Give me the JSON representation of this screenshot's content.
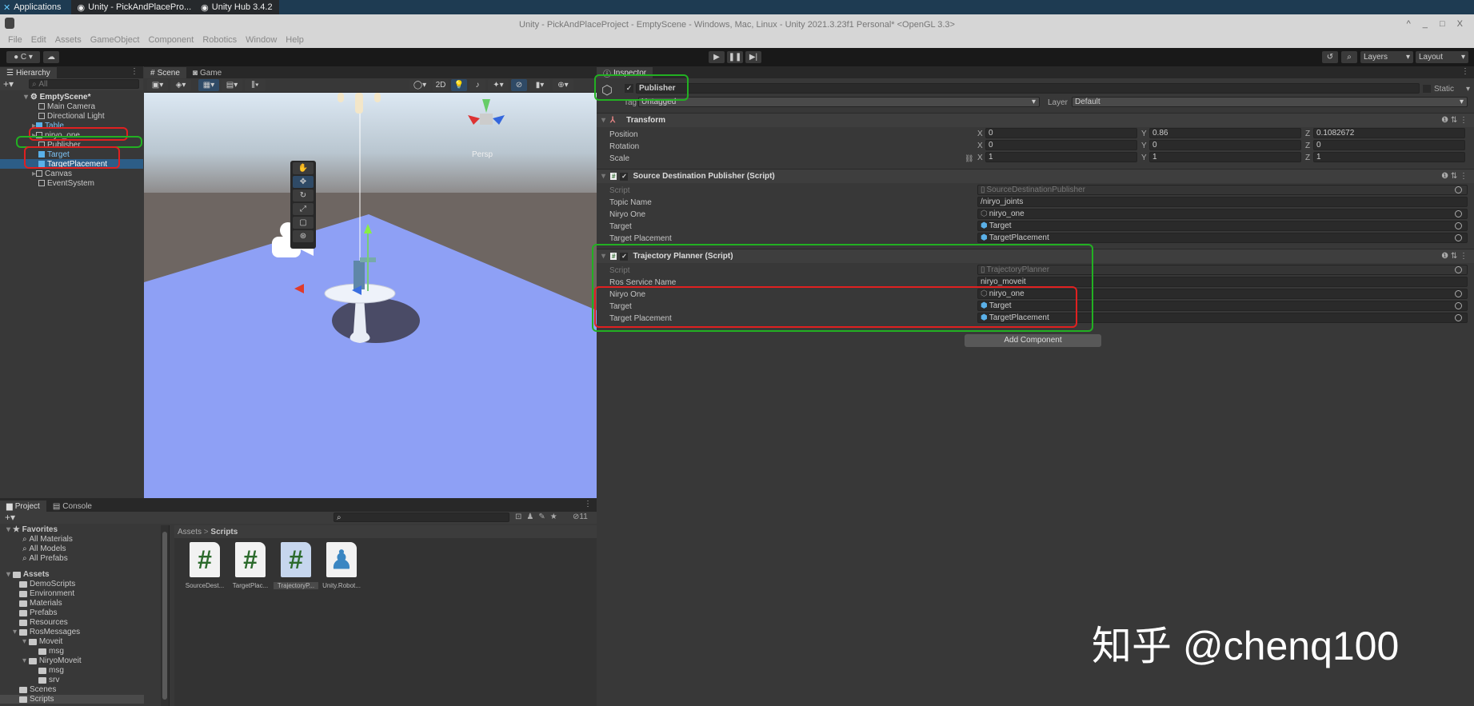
{
  "taskbar": {
    "applications": "Applications",
    "task1": "Unity - PickAndPlacePro...",
    "task2": "Unity Hub 3.4.2"
  },
  "window": {
    "title": "Unity - PickAndPlaceProject - EmptyScene - Windows, Mac, Linux - Unity 2021.3.23f1 Personal* <OpenGL 3.3>",
    "controls": "^ _ □ X"
  },
  "menu": [
    "File",
    "Edit",
    "Assets",
    "GameObject",
    "Component",
    "Robotics",
    "Window",
    "Help"
  ],
  "toolbar": {
    "account": "C",
    "layers": "Layers",
    "layout": "Layout"
  },
  "hierarchy": {
    "tab": "Hierarchy",
    "search_placeholder": "All",
    "scene": "EmptyScene*",
    "items": [
      {
        "label": "Main Camera"
      },
      {
        "label": "Directional Light"
      },
      {
        "label": "Table"
      },
      {
        "label": "niryo_one"
      },
      {
        "label": "Publisher"
      },
      {
        "label": "Target"
      },
      {
        "label": "TargetPlacement"
      },
      {
        "label": "Canvas"
      },
      {
        "label": "EventSystem"
      }
    ]
  },
  "scene": {
    "tab_scene": "Scene",
    "tab_game": "Game",
    "btn_2d": "2D",
    "persp": "Persp"
  },
  "inspector": {
    "tab": "Inspector",
    "object_name": "Publisher",
    "static": "Static",
    "tag_label": "Tag",
    "tag": "Untagged",
    "layer_label": "Layer",
    "layer": "Default",
    "transform": {
      "title": "Transform",
      "position_label": "Position",
      "rotation_label": "Rotation",
      "scale_label": "Scale",
      "position": {
        "x": "0",
        "y": "0.86",
        "z": "0.1082672"
      },
      "rotation": {
        "x": "0",
        "y": "0",
        "z": "0"
      },
      "scale": {
        "x": "1",
        "y": "1",
        "z": "1"
      }
    },
    "sdp": {
      "title": "Source Destination Publisher (Script)",
      "rows": [
        {
          "label": "Script",
          "value": "SourceDestinationPublisher"
        },
        {
          "label": "Topic Name",
          "value": "/niryo_joints"
        },
        {
          "label": "Niryo One",
          "value": "niryo_one"
        },
        {
          "label": "Target",
          "value": "Target"
        },
        {
          "label": "Target Placement",
          "value": "TargetPlacement"
        }
      ]
    },
    "tp": {
      "title": "Trajectory Planner (Script)",
      "rows": [
        {
          "label": "Script",
          "value": "TrajectoryPlanner"
        },
        {
          "label": "Ros Service Name",
          "value": "niryo_moveit"
        },
        {
          "label": "Niryo One",
          "value": "niryo_one"
        },
        {
          "label": "Target",
          "value": "Target"
        },
        {
          "label": "Target Placement",
          "value": "TargetPlacement"
        }
      ]
    },
    "add_component": "Add Component"
  },
  "project": {
    "tab_project": "Project",
    "tab_console": "Console",
    "hidden_count": "11",
    "favorites": "Favorites",
    "fav_items": [
      "All Materials",
      "All Models",
      "All Prefabs"
    ],
    "assets": "Assets",
    "folders": [
      "DemoScripts",
      "Environment",
      "Materials",
      "Prefabs",
      "Resources",
      "RosMessages",
      "Moveit",
      "msg",
      "NiryoMoveit",
      "msg",
      "srv",
      "Scenes",
      "Scripts"
    ],
    "breadcrumb": {
      "root": "Assets",
      "sep": ">",
      "current": "Scripts"
    },
    "files": [
      "SourceDest...",
      "TargetPlac...",
      "TrajectoryP...",
      "Unity.Robot..."
    ]
  },
  "watermark": "知乎 @chenq100",
  "colors": {
    "highlight_red": "#e02020",
    "highlight_green": "#22b022",
    "selection": "#2c5d87"
  }
}
